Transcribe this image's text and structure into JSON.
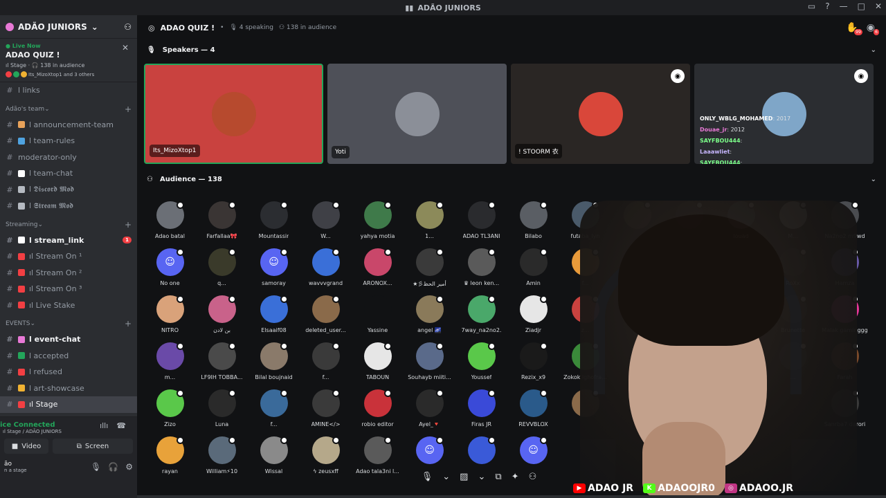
{
  "window": {
    "title": "ADÃO JUNIORS"
  },
  "sidebar": {
    "server_name": "ADÃO JUNIORS",
    "live": {
      "status": "Live Now",
      "title": "ADAO QUIZ !",
      "meta": "ıl Stage · 🎧 138 in audience",
      "people": "Its_MizoXtop1 and 3 others"
    },
    "channels_top": [
      {
        "name": "l links",
        "icon": "🔗"
      }
    ],
    "categories": [
      {
        "name": "Adão's team",
        "channels": [
          {
            "name": "l announcement-team",
            "icon": "#",
            "emoji_color": "#e8a25a"
          },
          {
            "name": "l team-rules",
            "icon": "#",
            "emoji_color": "#4fa3e0"
          },
          {
            "name": "moderator-only",
            "icon": "#",
            "emoji_color": ""
          },
          {
            "name": "l team-chat",
            "icon": "#",
            "emoji_color": "#ffffff"
          },
          {
            "name": "l 𝕯𝖎𝖘𝖈𝖔𝖗𝖉 𝕸𝖔𝖉",
            "icon": "#",
            "emoji_color": "#b5bac1"
          },
          {
            "name": "l 𝕾𝖙𝖗𝖊𝖆𝖒 𝕸𝖔𝖉",
            "icon": "#",
            "emoji_color": "#b5bac1"
          }
        ]
      },
      {
        "name": "Streaming",
        "channels": [
          {
            "name": "l stream_link",
            "icon": "#",
            "emoji_color": "#ffffff",
            "badge": "1",
            "bold": true
          },
          {
            "name": "ıl Stream On ¹",
            "icon": "#",
            "emoji_color": "#f23f43"
          },
          {
            "name": "ıl Stream On ²",
            "icon": "#",
            "emoji_color": "#f23f43"
          },
          {
            "name": "ıl Stream On ³",
            "icon": "#",
            "emoji_color": "#f23f43"
          },
          {
            "name": "ıl Live Stake",
            "icon": "#",
            "emoji_color": "#f23f43"
          }
        ]
      },
      {
        "name": "EVENTS",
        "channels": [
          {
            "name": "l event-chat",
            "icon": "#",
            "emoji_color": "#e879d6",
            "bold": true
          },
          {
            "name": "l accepted",
            "icon": "#",
            "emoji_color": "#23a55a"
          },
          {
            "name": "l refused",
            "icon": "#",
            "emoji_color": "#f23f43"
          },
          {
            "name": "l art-showcase",
            "icon": "#",
            "emoji_color": "#f0b232"
          },
          {
            "name": "ıl Stage",
            "icon": "#",
            "emoji_color": "#f23f43",
            "selected": true
          }
        ]
      }
    ],
    "voice": {
      "status": "ice Connected",
      "sub": "ıl Stage / ADÃO JUNIORS",
      "video_label": "Video",
      "screen_label": "Screen",
      "user": "ão",
      "user_sub": "n a stage"
    }
  },
  "header": {
    "title": "ADAO QUIZ !",
    "speaking": "4 speaking",
    "audience": "138 in audience",
    "badge_count": "99",
    "inbox_count": "6"
  },
  "speakers": {
    "title": "Speakers — 4",
    "tiles": [
      {
        "name": "Its_MizoXtop1",
        "bg": "#c9423f",
        "avatar": "#b74a2e"
      },
      {
        "name": "Yoti",
        "bg": "#4e5058",
        "avatar": "#8b8f98"
      },
      {
        "name": "! STOORM 衣",
        "bg": "#2a2624",
        "avatar": "#d9473a"
      },
      {
        "name": "",
        "bg": "#2b2d31",
        "avatar": "#7fa6c8"
      }
    ],
    "overlay_chat": [
      {
        "user": "ONLY_WBLG_MOHAMED",
        "msg": ": 2017",
        "color": "#ffffff"
      },
      {
        "user": "Douae_jr",
        "msg": ": 2012",
        "color": "#e879d6"
      },
      {
        "user": "SAYFBOU444",
        "msg": ":",
        "color": "#7cff8a"
      },
      {
        "user": "Laaawliet",
        "msg": ":",
        "color": "#c7b6ff"
      },
      {
        "user": "SAYFBOU444",
        "msg": ":",
        "color": "#7cff8a"
      }
    ]
  },
  "audience": {
    "title": "Audience — 138",
    "members": [
      {
        "name": "Adao batal",
        "color": "#6b6f76"
      },
      {
        "name": "Farfallaa🎀",
        "color": "#3a3534"
      },
      {
        "name": "Mountassir",
        "color": "#2b2d31"
      },
      {
        "name": "W...",
        "color": "#3f4046"
      },
      {
        "name": "yahya motia",
        "color": "#3f7a4a"
      },
      {
        "name": "1...",
        "color": "#8c8a5a"
      },
      {
        "name": "ADAO TL3ANI",
        "color": "#2a2b2e"
      },
      {
        "name": "Bilabo",
        "color": "#5a5e64"
      },
      {
        "name": "futaba_lyn",
        "color": "#4a5a6a"
      },
      {
        "name": "",
        "color": "#7a5a3a"
      },
      {
        "name": "",
        "color": "#2b2d31"
      },
      {
        "name": "louad",
        "color": "#5e6470"
      },
      {
        "name": "M...",
        "color": "#e6e6e6"
      },
      {
        "name": "Na2no2 m9wd",
        "color": "#4a4c50"
      },
      {
        "name": "No one",
        "color": "#5865f2"
      },
      {
        "name": "q...",
        "color": "#3a3a2a"
      },
      {
        "name": "samoray",
        "color": "#5865f2"
      },
      {
        "name": "wavvvgrand",
        "color": "#3a6fd8"
      },
      {
        "name": "ARONOX...",
        "color": "#c9476a"
      },
      {
        "name": "★彡أمير الحظ",
        "color": "#3a3a3a"
      },
      {
        "name": "♛ leon ken...",
        "color": "#5a5a5a"
      },
      {
        "name": "Amin",
        "color": "#2a2a2a"
      },
      {
        "name": "f...",
        "color": "#e89a3a"
      },
      {
        "name": "",
        "color": "#111214"
      },
      {
        "name": "",
        "color": "#111214"
      },
      {
        "name": "",
        "color": "#111214"
      },
      {
        "name": "RoXx",
        "color": "#2a2a2a"
      },
      {
        "name": "Hamza",
        "color": "#6a5aa8"
      },
      {
        "name": "NITRO",
        "color": "#d9a27a"
      },
      {
        "name": "بن لادن",
        "color": "#c9628a"
      },
      {
        "name": "Elsaaif08",
        "color": "#3a6fd8"
      },
      {
        "name": "deleted_user...",
        "color": "#8a6a4a"
      },
      {
        "name": "Yassine",
        "color": "#111214"
      },
      {
        "name": "angel 🌌",
        "color": "#8a7a5a"
      },
      {
        "name": "7way_na2no2.",
        "color": "#4aa86a"
      },
      {
        "name": "Ziadjr",
        "color": "#e6e6e6"
      },
      {
        "name": "z...",
        "color": "#c9423f"
      },
      {
        "name": "",
        "color": "#111214"
      },
      {
        "name": "",
        "color": "#111214"
      },
      {
        "name": "",
        "color": "#111214"
      },
      {
        "name": "Brunette",
        "color": "#2a2a2a"
      },
      {
        "name": "Malak gaminggg",
        "color": "#e8379a"
      },
      {
        "name": "m...",
        "color": "#6a4aa8"
      },
      {
        "name": "LF9IH TOBBA...",
        "color": "#4a4a4a"
      },
      {
        "name": "Bilal boujnaid",
        "color": "#8a7a6a"
      },
      {
        "name": "f...",
        "color": "#3a3a3a"
      },
      {
        "name": "TABOUN",
        "color": "#e6e6e6"
      },
      {
        "name": "Souhayb miiti...",
        "color": "#5a6a8a"
      },
      {
        "name": "Youssef",
        "color": "#5ac84a"
      },
      {
        "name": "Rezix_x9",
        "color": "#1a1a1a"
      },
      {
        "name": "Zokok lghofra...",
        "color": "#3a8a3a"
      },
      {
        "name": "",
        "color": "#111214"
      },
      {
        "name": "",
        "color": "#111214"
      },
      {
        "name": "",
        "color": "#111214"
      },
      {
        "name": "...",
        "color": "#3a3a3a"
      },
      {
        "name": "Farah",
        "color": "#7a4a2a"
      },
      {
        "name": "Zizo",
        "color": "#5ac84a"
      },
      {
        "name": "Luna",
        "color": "#2a2a2a"
      },
      {
        "name": "f...",
        "color": "#3a6a9a"
      },
      {
        "name": "AMINE</>",
        "color": "#3a3a3a"
      },
      {
        "name": "robio editor",
        "color": "#c9323a"
      },
      {
        "name": "Ayel_🔻",
        "color": "#2a2a2a"
      },
      {
        "name": "Firas JR",
        "color": "#3a4ad8"
      },
      {
        "name": "REVVBLOX",
        "color": "#2a5a8a"
      },
      {
        "name": "",
        "color": "#8a6a4a"
      },
      {
        "name": "",
        "color": "#111214"
      },
      {
        "name": "",
        "color": "#111214"
      },
      {
        "name": "",
        "color": "#111214"
      },
      {
        "name": "",
        "color": "#111214"
      },
      {
        "name": "Sanrba7 darori",
        "color": "#3a3a3a"
      },
      {
        "name": "rayan",
        "color": "#e8a23a"
      },
      {
        "name": "William⚡10",
        "color": "#5a6a7a"
      },
      {
        "name": "Wissal",
        "color": "#8a8a8a"
      },
      {
        "name": "ϟ zeusxff",
        "color": "#b5a88a"
      },
      {
        "name": "Adao tala3ni l...",
        "color": "#5a5a5a"
      },
      {
        "name": "",
        "color": "#5865f2"
      },
      {
        "name": "",
        "color": "#3a5ad8"
      },
      {
        "name": "",
        "color": "#5865f2"
      }
    ]
  },
  "overlay_socials": [
    {
      "label": "ADAO JR",
      "logo": "▶",
      "logo_bg": "#ff0000"
    },
    {
      "label": "ADAOOJR0",
      "logo": "K",
      "logo_bg": "#53fc18"
    },
    {
      "label": "ADAOO.JR",
      "logo": "◎",
      "logo_bg": "#c13584"
    }
  ]
}
